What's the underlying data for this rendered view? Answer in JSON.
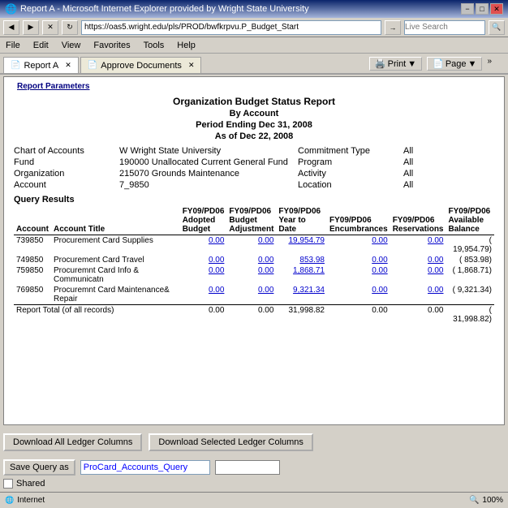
{
  "window": {
    "title": "Report A - Microsoft Internet Explorer provided by Wright State University",
    "minimize_label": "−",
    "maximize_label": "□",
    "close_label": "✕"
  },
  "address_bar": {
    "url": "https://oas5.wright.edu/pls/PROD/bwfkrpvu.P_Budget_Start",
    "search_placeholder": "Live Search"
  },
  "menu": {
    "items": [
      "File",
      "Edit",
      "View",
      "Favorites",
      "Tools",
      "Help"
    ]
  },
  "tabs": [
    {
      "label": "Report A",
      "active": true
    },
    {
      "label": "Approve Documents",
      "active": false
    }
  ],
  "toolbar_right": {
    "print_label": "Print",
    "page_label": "Page"
  },
  "report": {
    "params_label": "Report Parameters",
    "title": "Organization Budget Status Report",
    "subtitle1": "By Account",
    "subtitle2": "Period Ending Dec 31, 2008",
    "subtitle3": "As of Dec 22, 2008",
    "params": [
      {
        "label": "Chart of Accounts",
        "value": "W Wright State University",
        "label2": "Commitment Type",
        "value2": "All"
      },
      {
        "label": "Fund",
        "value": "190000 Unallocated Current General Fund",
        "label2": "Program",
        "value2": "All"
      },
      {
        "label": "Organization",
        "value": "215070 Grounds Maintenance",
        "label2": "Activity",
        "value2": "All"
      },
      {
        "label": "Account",
        "value": "7_9850",
        "label2": "Location",
        "value2": "All"
      }
    ],
    "query_results_label": "Query Results",
    "table": {
      "headers": [
        "Account",
        "Account Title",
        "FY09/PD06\nAdopted\nBudget",
        "FY09/PD06\nBudget\nAdjustment",
        "FY09/PD06\nYear to Date",
        "FY09/PD06\nEncumbrances",
        "FY09/PD06\nReservations",
        "FY09/PD06\nAvailable\nBalance"
      ],
      "rows": [
        {
          "account": "739850",
          "title": "Procurement Card Supplies",
          "adopted": "0.00",
          "adjustment": "0.00",
          "ytd": "19,954.79",
          "encumbrances": "0.00",
          "reservations": "0.00",
          "balance": "( 19,954.79)"
        },
        {
          "account": "749850",
          "title": "Procurement Card Travel",
          "adopted": "0.00",
          "adjustment": "0.00",
          "ytd": "853.98",
          "encumbrances": "0.00",
          "reservations": "0.00",
          "balance": "( 853.98)"
        },
        {
          "account": "759850",
          "title": "Procuremnt Card Info & Communicatn",
          "adopted": "0.00",
          "adjustment": "0.00",
          "ytd": "1,868.71",
          "encumbrances": "0.00",
          "reservations": "0.00",
          "balance": "( 1,868.71)"
        },
        {
          "account": "769850",
          "title": "Procuremnt Card Maintenance& Repair",
          "adopted": "0.00",
          "adjustment": "0.00",
          "ytd": "9,321.34",
          "encumbrances": "0.00",
          "reservations": "0.00",
          "balance": "( 9,321.34)"
        }
      ],
      "total": {
        "label": "Report Total (of all records)",
        "adopted": "0.00",
        "adjustment": "0.00",
        "ytd": "31,998.82",
        "encumbrances": "0.00",
        "reservations": "0.00",
        "balance": "( 31,998.82)"
      }
    }
  },
  "buttons": {
    "download_all": "Download All Ledger Columns",
    "download_selected": "Download Selected Ledger Columns",
    "save_query": "Save Query as",
    "save_input_value": "ProCard_Accounts_Query",
    "shared_label": "Shared"
  },
  "status_bar": {
    "zone": "Internet",
    "zoom": "100%"
  }
}
